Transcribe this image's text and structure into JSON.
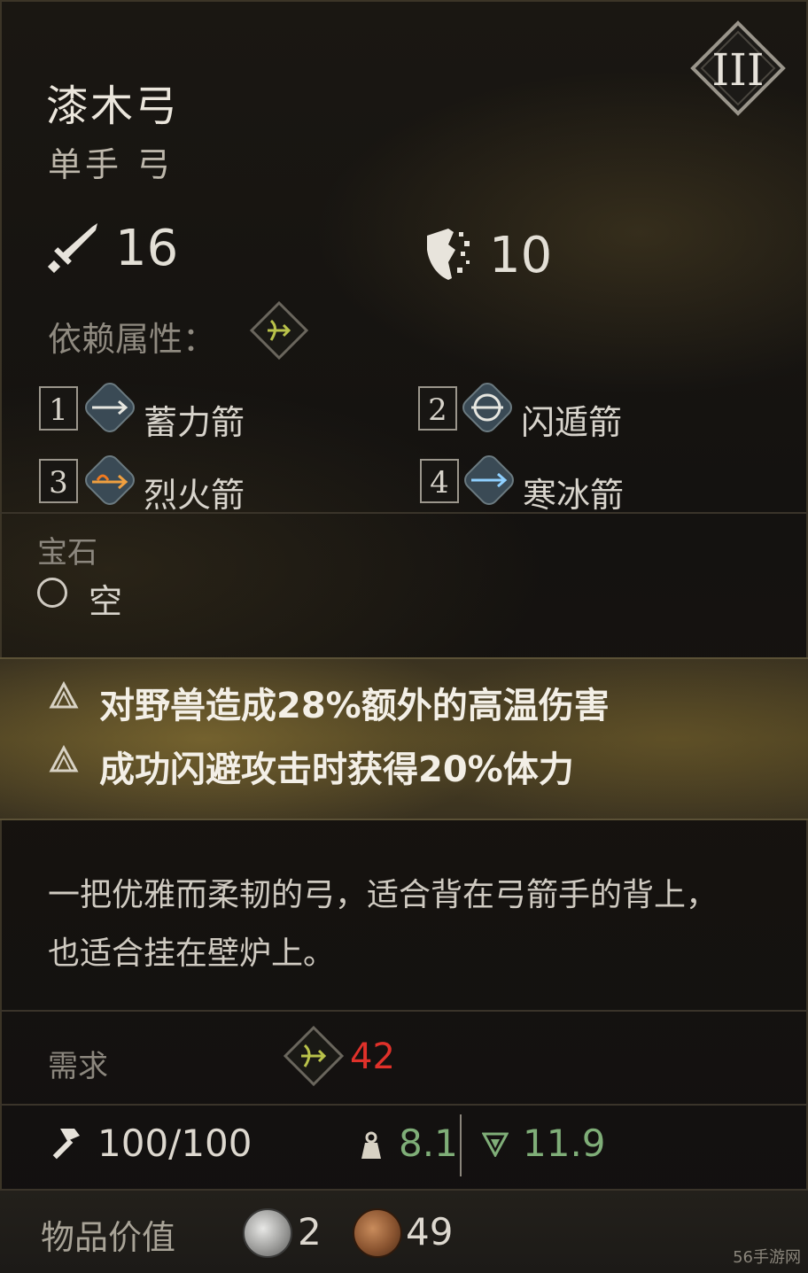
{
  "item": {
    "name": "漆木弓",
    "type": "单手 弓",
    "tier": "III"
  },
  "stats": {
    "attack": "16",
    "defense": "10"
  },
  "dependency": {
    "label": "依赖属性："
  },
  "skills": [
    {
      "key": "1",
      "name": "蓄力箭"
    },
    {
      "key": "2",
      "name": "闪遁箭"
    },
    {
      "key": "3",
      "name": "烈火箭"
    },
    {
      "key": "4",
      "name": "寒冰箭"
    }
  ],
  "gem": {
    "label": "宝石",
    "value": "空"
  },
  "bonuses": [
    "对野兽造成28%额外的高温伤害",
    "成功闪避攻击时获得20%体力"
  ],
  "description": "一把优雅而柔韧的弓，适合背在弓箭手的背上，也适合挂在壁炉上。",
  "requirement": {
    "label": "需求",
    "value": "42"
  },
  "durability": "100/100",
  "weight": "8.1",
  "poise": "11.9",
  "item_value": {
    "label": "物品价值",
    "silver": "2",
    "copper": "49"
  },
  "watermark": "56手游网",
  "colors": {
    "requirement": "#e0312a",
    "weight": "#7fae78",
    "bonus_band": "#4a3f22"
  }
}
